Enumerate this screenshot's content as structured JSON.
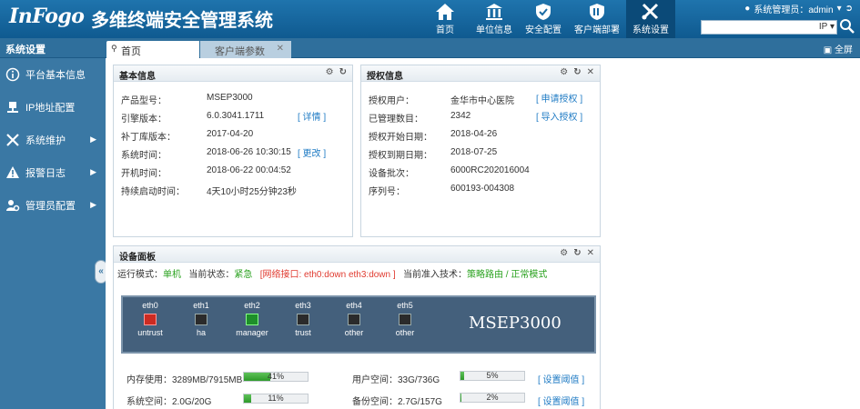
{
  "header": {
    "logo": "InFogo",
    "title": "多维终端安全管理系统",
    "nav": [
      {
        "label": "首页",
        "icon": "home-icon"
      },
      {
        "label": "单位信息",
        "icon": "building-icon"
      },
      {
        "label": "安全配置",
        "icon": "shield-check-icon"
      },
      {
        "label": "客户端部署",
        "icon": "deploy-shield-icon"
      },
      {
        "label": "系统设置",
        "icon": "tools-icon"
      }
    ],
    "user_label": "系统管理员：admin",
    "search_select": "IP"
  },
  "subbar": {
    "sidebar_title": "系统设置",
    "tabs": [
      {
        "label": "首页"
      },
      {
        "label": "客户端参数"
      }
    ],
    "fullscreen": "全屏"
  },
  "sidebar": {
    "items": [
      {
        "label": "平台基本信息",
        "icon": "info-icon"
      },
      {
        "label": "IP地址配置",
        "icon": "network-icon"
      },
      {
        "label": "系统维护",
        "icon": "wrench-icon"
      },
      {
        "label": "报警日志",
        "icon": "warning-icon"
      },
      {
        "label": "管理员配置",
        "icon": "admin-gear-icon"
      }
    ]
  },
  "basic_info": {
    "title": "基本信息",
    "rows": [
      {
        "label": "产品型号：",
        "value": "MSEP3000",
        "action": ""
      },
      {
        "label": "引擎版本：",
        "value": "6.0.3041.1711",
        "action": "[ 详情 ]"
      },
      {
        "label": "补丁库版本：",
        "value": "2017-04-20",
        "action": ""
      },
      {
        "label": "系统时间：",
        "value": "2018-06-26 10:30:15",
        "action": "[ 更改 ]"
      },
      {
        "label": "开机时间：",
        "value": "2018-06-22 00:04:52",
        "action": ""
      },
      {
        "label": "持续启动时间：",
        "value": "4天10小时25分钟23秒",
        "action": ""
      }
    ]
  },
  "license_info": {
    "title": "授权信息",
    "rows": [
      {
        "label": "授权用户：",
        "value": "金华市中心医院",
        "action": "[ 申请授权 ]"
      },
      {
        "label": "已管理数目：",
        "value": "2342",
        "action": "[ 导入授权 ]"
      },
      {
        "label": "授权开始日期：",
        "value": "2018-04-26",
        "action": ""
      },
      {
        "label": "授权到期日期：",
        "value": "2018-07-25",
        "action": ""
      },
      {
        "label": "设备批次：",
        "value": "6000RC202016004",
        "action": ""
      },
      {
        "label": "序列号：",
        "value": "600193-004308",
        "action": ""
      }
    ]
  },
  "device_panel": {
    "title": "设备面板",
    "mode_label": "运行模式：",
    "mode_value": "单机",
    "state_label": "当前状态：",
    "state_value": "紧急",
    "iface_status": "[网络接口: eth0:down eth3:down ]",
    "tech_label": "当前准入技术：",
    "tech_value": "策略路由 / 正常模式",
    "device_name": "MSEP3000",
    "ports": [
      {
        "name": "eth0",
        "role": "untrust",
        "state": "down"
      },
      {
        "name": "eth1",
        "role": "ha",
        "state": "idle"
      },
      {
        "name": "eth2",
        "role": "manager",
        "state": "up"
      },
      {
        "name": "eth3",
        "role": "trust",
        "state": "idle"
      },
      {
        "name": "eth4",
        "role": "other",
        "state": "idle"
      },
      {
        "name": "eth5",
        "role": "other",
        "state": "idle"
      }
    ],
    "stats": [
      {
        "label": "内存使用：3289MB/7915MB",
        "percent": 41,
        "text": "41%"
      },
      {
        "label": "用户空间：33G/736G",
        "percent": 5,
        "text": "5%",
        "action": "[ 设置阈值 ]"
      },
      {
        "label": "系统空间：2.0G/20G",
        "percent": 11,
        "text": "11%"
      },
      {
        "label": "备份空间：2.7G/157G",
        "percent": 2,
        "text": "2%",
        "action": "[ 设置阈值 ]"
      }
    ]
  },
  "colors": {
    "header": "#1a6aa3",
    "sidebar": "#3a78a4",
    "link": "#1f7bc4",
    "ok": "#2aa21f",
    "alert": "#e03a2f"
  }
}
